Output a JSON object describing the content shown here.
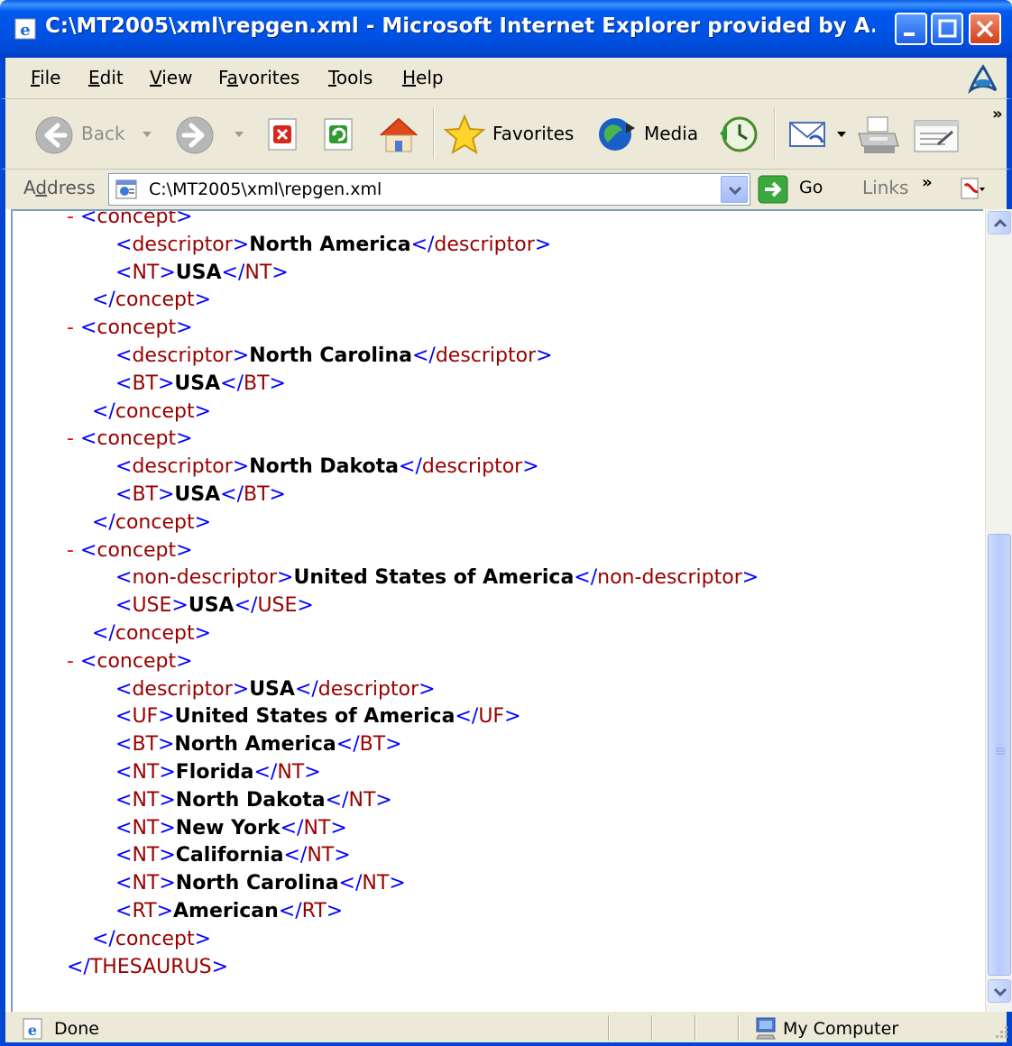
{
  "window": {
    "title": "C:\\MT2005\\xml\\repgen.xml - Microsoft Internet Explorer provided by A..."
  },
  "menu": {
    "items": [
      {
        "label": "File",
        "acc": "F",
        "rest": "ile"
      },
      {
        "label": "Edit",
        "acc": "E",
        "rest": "dit"
      },
      {
        "label": "View",
        "acc": "V",
        "rest": "iew"
      },
      {
        "label": "Favorites",
        "pre": "F",
        "acc": "a",
        "rest": "vorites"
      },
      {
        "label": "Tools",
        "acc": "T",
        "rest": "ools"
      },
      {
        "label": "Help",
        "acc": "H",
        "rest": "elp"
      }
    ]
  },
  "toolbar": {
    "back_label": "Back",
    "favorites_label": "Favorites",
    "media_label": "Media"
  },
  "address": {
    "label_pre": "A",
    "label_acc": "d",
    "label_rest": "dress",
    "value": "C:\\MT2005\\xml\\repgen.xml",
    "go_label": "Go",
    "links_label": "Links"
  },
  "xml": {
    "lines": [
      {
        "minus": "-",
        "open": "concept",
        "indent": 0
      },
      {
        "open": "descriptor",
        "text": "North America",
        "close": "descriptor",
        "indent": 1
      },
      {
        "open": "NT",
        "text": "USA",
        "close": "NT",
        "indent": 1
      },
      {
        "closeonly": "concept",
        "indent": 0
      },
      {
        "minus": "-",
        "open": "concept",
        "indent": 0
      },
      {
        "open": "descriptor",
        "text": "North Carolina",
        "close": "descriptor",
        "indent": 1
      },
      {
        "open": "BT",
        "text": "USA",
        "close": "BT",
        "indent": 1
      },
      {
        "closeonly": "concept",
        "indent": 0
      },
      {
        "minus": "-",
        "open": "concept",
        "indent": 0
      },
      {
        "open": "descriptor",
        "text": "North Dakota",
        "close": "descriptor",
        "indent": 1
      },
      {
        "open": "BT",
        "text": "USA",
        "close": "BT",
        "indent": 1
      },
      {
        "closeonly": "concept",
        "indent": 0
      },
      {
        "minus": "-",
        "open": "concept",
        "indent": 0
      },
      {
        "open": "non-descriptor",
        "text": "United States of America",
        "close": "non-descriptor",
        "indent": 1
      },
      {
        "open": "USE",
        "text": "USA",
        "close": "USE",
        "indent": 1
      },
      {
        "closeonly": "concept",
        "indent": 0
      },
      {
        "minus": "-",
        "open": "concept",
        "indent": 0
      },
      {
        "open": "descriptor",
        "text": "USA",
        "close": "descriptor",
        "indent": 1
      },
      {
        "open": "UF",
        "text": "United States of America",
        "close": "UF",
        "indent": 1
      },
      {
        "open": "BT",
        "text": "North America",
        "close": "BT",
        "indent": 1
      },
      {
        "open": "NT",
        "text": "Florida",
        "close": "NT",
        "indent": 1
      },
      {
        "open": "NT",
        "text": "North Dakota",
        "close": "NT",
        "indent": 1
      },
      {
        "open": "NT",
        "text": "New York",
        "close": "NT",
        "indent": 1
      },
      {
        "open": "NT",
        "text": "California",
        "close": "NT",
        "indent": 1
      },
      {
        "open": "NT",
        "text": "North Carolina",
        "close": "NT",
        "indent": 1
      },
      {
        "open": "RT",
        "text": "American",
        "close": "RT",
        "indent": 1
      },
      {
        "closeonly": "concept",
        "indent": 0
      },
      {
        "closeonly": "THESAURUS",
        "indent": -1
      }
    ]
  },
  "status": {
    "text": "Done",
    "zone": "My Computer"
  },
  "colors": {
    "xp_blue": "#0046d0",
    "bracket": "#0000ff",
    "tag": "#990000",
    "minus": "#ff0000"
  }
}
